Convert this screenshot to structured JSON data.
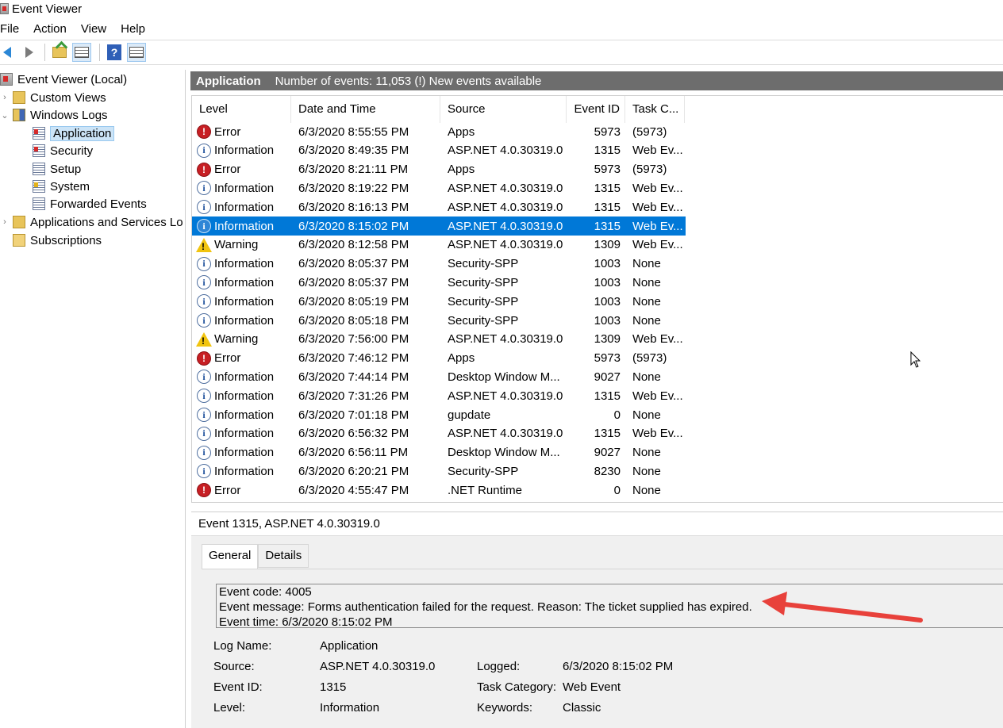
{
  "window": {
    "title": "Event Viewer"
  },
  "menu": [
    "File",
    "Action",
    "View",
    "Help"
  ],
  "toolbar": {
    "help_label": "?"
  },
  "tree": {
    "root": "Event Viewer (Local)",
    "custom_views": "Custom Views",
    "windows_logs": "Windows Logs",
    "application": "Application",
    "security": "Security",
    "setup": "Setup",
    "system": "System",
    "forwarded": "Forwarded Events",
    "apps_services": "Applications and Services Lo",
    "subscriptions": "Subscriptions"
  },
  "log_header": {
    "name": "Application",
    "info": "Number of events: 11,053 (!) New events available"
  },
  "table": {
    "columns": [
      "Level",
      "Date and Time",
      "Source",
      "Event ID",
      "Task C..."
    ],
    "rows": [
      {
        "level": "Error",
        "type": "error",
        "date": "6/3/2020 8:55:55 PM",
        "source": "Apps",
        "id": "5973",
        "task": "(5973)"
      },
      {
        "level": "Information",
        "type": "info",
        "date": "6/3/2020 8:49:35 PM",
        "source": "ASP.NET 4.0.30319.0",
        "id": "1315",
        "task": "Web Ev..."
      },
      {
        "level": "Error",
        "type": "error",
        "date": "6/3/2020 8:21:11 PM",
        "source": "Apps",
        "id": "5973",
        "task": "(5973)"
      },
      {
        "level": "Information",
        "type": "info",
        "date": "6/3/2020 8:19:22 PM",
        "source": "ASP.NET 4.0.30319.0",
        "id": "1315",
        "task": "Web Ev..."
      },
      {
        "level": "Information",
        "type": "info",
        "date": "6/3/2020 8:16:13 PM",
        "source": "ASP.NET 4.0.30319.0",
        "id": "1315",
        "task": "Web Ev..."
      },
      {
        "level": "Information",
        "type": "info",
        "date": "6/3/2020 8:15:02 PM",
        "source": "ASP.NET 4.0.30319.0",
        "id": "1315",
        "task": "Web Ev...",
        "selected": true
      },
      {
        "level": "Warning",
        "type": "warn",
        "date": "6/3/2020 8:12:58 PM",
        "source": "ASP.NET 4.0.30319.0",
        "id": "1309",
        "task": "Web Ev..."
      },
      {
        "level": "Information",
        "type": "info",
        "date": "6/3/2020 8:05:37 PM",
        "source": "Security-SPP",
        "id": "1003",
        "task": "None"
      },
      {
        "level": "Information",
        "type": "info",
        "date": "6/3/2020 8:05:37 PM",
        "source": "Security-SPP",
        "id": "1003",
        "task": "None"
      },
      {
        "level": "Information",
        "type": "info",
        "date": "6/3/2020 8:05:19 PM",
        "source": "Security-SPP",
        "id": "1003",
        "task": "None"
      },
      {
        "level": "Information",
        "type": "info",
        "date": "6/3/2020 8:05:18 PM",
        "source": "Security-SPP",
        "id": "1003",
        "task": "None"
      },
      {
        "level": "Warning",
        "type": "warn",
        "date": "6/3/2020 7:56:00 PM",
        "source": "ASP.NET 4.0.30319.0",
        "id": "1309",
        "task": "Web Ev..."
      },
      {
        "level": "Error",
        "type": "error",
        "date": "6/3/2020 7:46:12 PM",
        "source": "Apps",
        "id": "5973",
        "task": "(5973)"
      },
      {
        "level": "Information",
        "type": "info",
        "date": "6/3/2020 7:44:14 PM",
        "source": "Desktop Window M...",
        "id": "9027",
        "task": "None"
      },
      {
        "level": "Information",
        "type": "info",
        "date": "6/3/2020 7:31:26 PM",
        "source": "ASP.NET 4.0.30319.0",
        "id": "1315",
        "task": "Web Ev..."
      },
      {
        "level": "Information",
        "type": "info",
        "date": "6/3/2020 7:01:18 PM",
        "source": "gupdate",
        "id": "0",
        "task": "None"
      },
      {
        "level": "Information",
        "type": "info",
        "date": "6/3/2020 6:56:32 PM",
        "source": "ASP.NET 4.0.30319.0",
        "id": "1315",
        "task": "Web Ev..."
      },
      {
        "level": "Information",
        "type": "info",
        "date": "6/3/2020 6:56:11 PM",
        "source": "Desktop Window M...",
        "id": "9027",
        "task": "None"
      },
      {
        "level": "Information",
        "type": "info",
        "date": "6/3/2020 6:20:21 PM",
        "source": "Security-SPP",
        "id": "8230",
        "task": "None"
      },
      {
        "level": "Error",
        "type": "error",
        "date": "6/3/2020 4:55:47 PM",
        "source": ".NET Runtime",
        "id": "0",
        "task": "None"
      }
    ]
  },
  "detail": {
    "title": "Event 1315, ASP.NET 4.0.30319.0",
    "tabs": [
      "General",
      "Details"
    ],
    "message_lines": [
      "Event code: 4005",
      "Event message: Forms authentication failed for the request. Reason: The ticket supplied has expired.",
      "Event time: 6/3/2020 8:15:02 PM"
    ],
    "props": {
      "log_name_label": "Log Name:",
      "log_name": "Application",
      "source_label": "Source:",
      "source": "ASP.NET 4.0.30319.0",
      "logged_label": "Logged:",
      "logged": "6/3/2020 8:15:02 PM",
      "event_id_label": "Event ID:",
      "event_id": "1315",
      "task_cat_label": "Task Category:",
      "task_cat": "Web Event",
      "level_label": "Level:",
      "level": "Information",
      "keywords_label": "Keywords:",
      "keywords": "Classic"
    }
  },
  "colors": {
    "selection": "#0078d7",
    "header_band": "#6d6d6d",
    "annotation": "#e8413b"
  }
}
